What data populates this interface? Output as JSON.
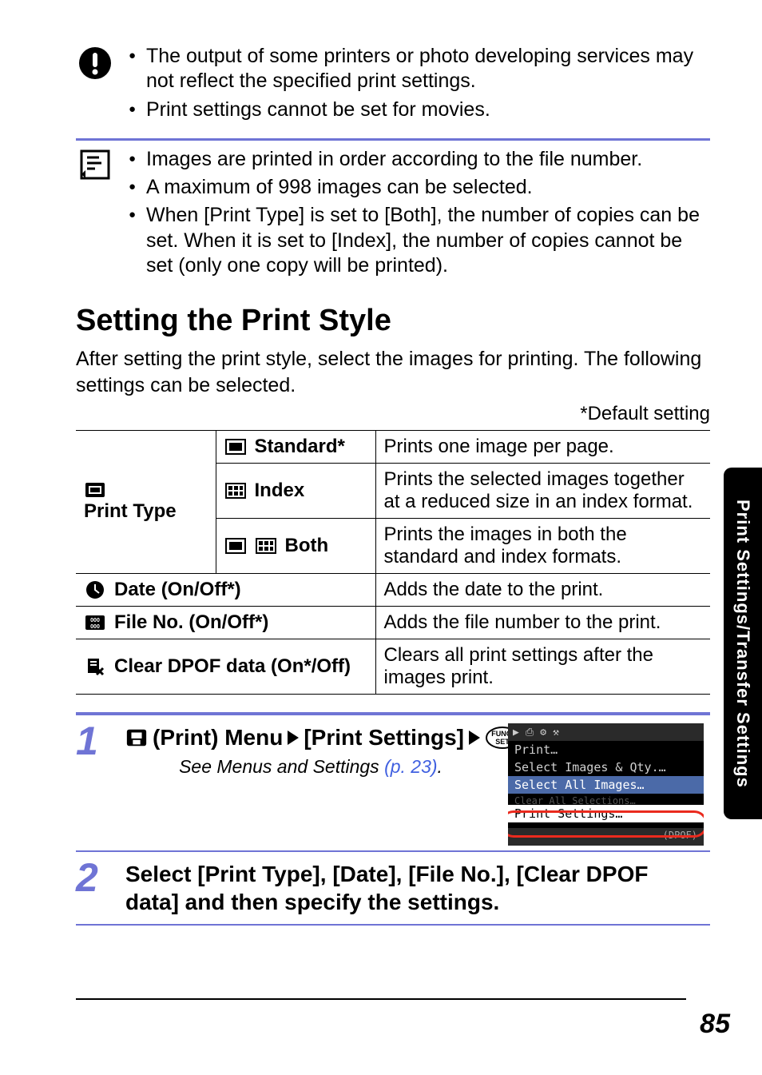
{
  "warning": {
    "items": [
      "The output of some printers or photo developing services may not reflect the specified print settings.",
      "Print settings cannot be set for movies."
    ]
  },
  "note": {
    "items": [
      "Images are printed in order according to the file number.",
      "A maximum of 998 images can be selected.",
      "When [Print Type] is set to [Both], the number of copies can be set. When it is set to [Index], the number of copies cannot be set (only one copy will be printed)."
    ]
  },
  "heading": "Setting the Print Style",
  "intro": "After setting the print style, select the images for printing. The following settings can be selected.",
  "default_note": "*Default setting",
  "table": {
    "print_type_label": "Print Type",
    "standard_label": "Standard*",
    "standard_desc": "Prints one image per page.",
    "index_label": "Index",
    "index_desc": "Prints the selected images together at a reduced size in an index format.",
    "both_label": "Both",
    "both_desc": "Prints the images in both the standard and index formats.",
    "date_label": "Date (On/Off*)",
    "date_desc": "Adds the date to the print.",
    "fileno_label": "File No. (On/Off*)",
    "fileno_desc": "Adds the file number to the print.",
    "clear_label": "Clear DPOF data (On*/Off)",
    "clear_desc": "Clears all print settings after the images print."
  },
  "steps": {
    "s1": {
      "num": "1",
      "menu_label": "(Print) Menu",
      "target": "[Print Settings]",
      "end": ".",
      "see_pre": "See Menus and Settings ",
      "see_link": "(p. 23)",
      "see_post": "."
    },
    "s2": {
      "num": "2",
      "text": "Select [Print Type], [Date], [File No.], [Clear DPOF data] and then specify the settings."
    }
  },
  "lcd": {
    "rows": [
      "Print…",
      "Select Images & Qty.…",
      "Select All Images…",
      "Clear All Selections…",
      "Print Settings…"
    ],
    "foot_left": "",
    "foot_right": "(DPOF)"
  },
  "side_tab": "Print Settings/Transfer Settings",
  "page_num": "85"
}
